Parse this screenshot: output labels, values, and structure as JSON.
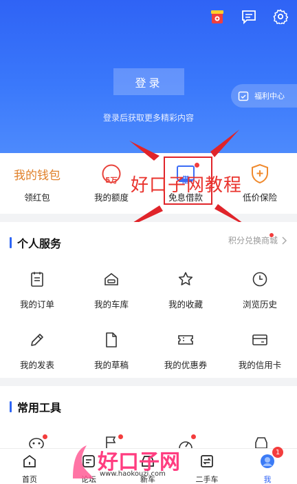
{
  "header": {
    "login_label": "登录",
    "login_hint": "登录后获取更多精彩内容",
    "welfare_label": "福利中心",
    "icons": [
      "gift-icon",
      "message-icon",
      "settings-icon"
    ]
  },
  "wallet": {
    "title": "我的钱包",
    "items": [
      {
        "label": "领红包"
      },
      {
        "label": "我的额度",
        "icon_text": "5万"
      },
      {
        "label": "免息借款",
        "icon_text": "借"
      },
      {
        "label": "低价保险"
      }
    ]
  },
  "watermark": {
    "overlay_text": "好口子网教程",
    "logo_text": "好口子网",
    "logo_url": "www.haokouzi.com"
  },
  "personal": {
    "title": "个人服务",
    "link_label": "积分兑换商城",
    "items": [
      {
        "label": "我的订单",
        "icon": "clipboard-icon"
      },
      {
        "label": "我的车库",
        "icon": "garage-icon"
      },
      {
        "label": "我的收藏",
        "icon": "star-icon"
      },
      {
        "label": "浏览历史",
        "icon": "clock-icon"
      },
      {
        "label": "我的发表",
        "icon": "pencil-icon"
      },
      {
        "label": "我的草稿",
        "icon": "document-icon"
      },
      {
        "label": "我的优惠券",
        "icon": "coupon-icon"
      },
      {
        "label": "我的信用卡",
        "icon": "credit-card-icon"
      }
    ]
  },
  "tools": {
    "title": "常用工具"
  },
  "tabbar": {
    "tabs": [
      {
        "label": "首页"
      },
      {
        "label": "论坛"
      },
      {
        "label": "新车"
      },
      {
        "label": "二手车"
      },
      {
        "label": "我"
      }
    ],
    "badge_count": "1"
  },
  "colors": {
    "brand_blue": "#2f63f5",
    "wallet_title": "#e0802a",
    "alert_red": "#e0242a"
  }
}
